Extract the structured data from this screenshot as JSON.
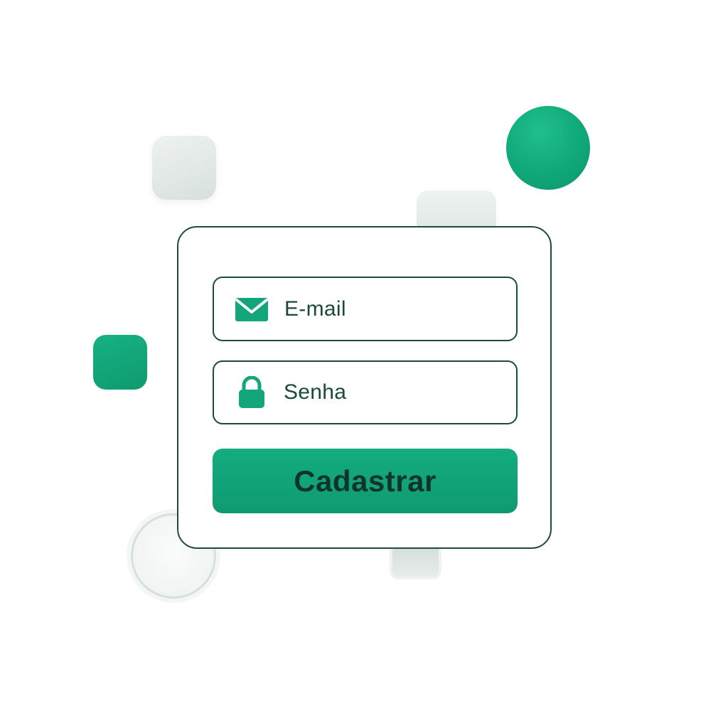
{
  "form": {
    "email_placeholder": "E-mail",
    "email_icon": "envelope-icon",
    "password_placeholder": "Senha",
    "password_icon": "lock-icon",
    "submit_label": "Cadastrar"
  },
  "colors": {
    "accent": "#12a67a",
    "border": "#1e4a3e",
    "text": "#1a4a3c",
    "button_text": "#10342a"
  }
}
